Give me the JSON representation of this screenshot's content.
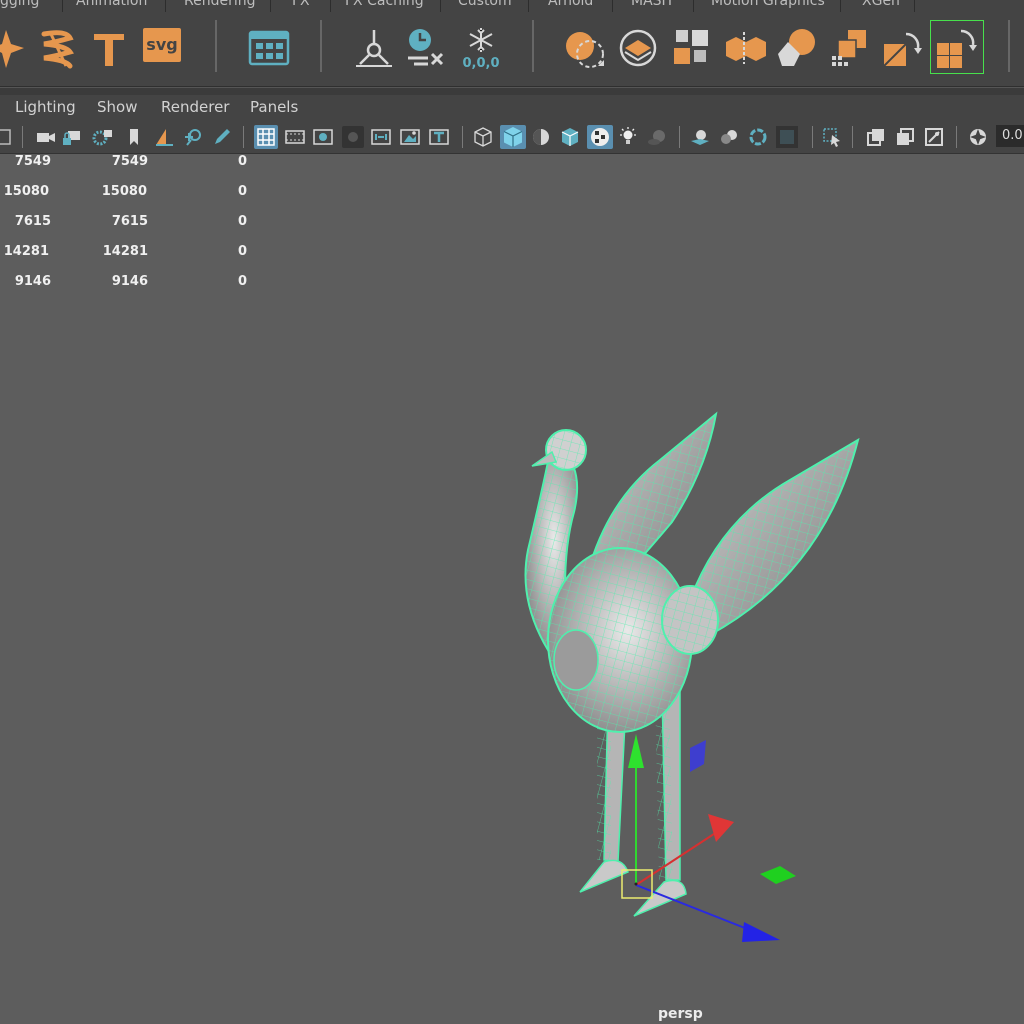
{
  "tabs": [
    "gging",
    "Animation",
    "Rendering",
    "FX",
    "FX Caching",
    "Custom",
    "Arnold",
    "MASH",
    "Motion Graphics",
    "XGen"
  ],
  "shelf": {
    "svg_label": "svg",
    "snowflake_readout": "0,0,0"
  },
  "panel_menu": [
    "Lighting",
    "Show",
    "Renderer",
    "Panels"
  ],
  "toolbar": {
    "field_value": "0.0"
  },
  "hud": {
    "rows": [
      [
        "7549",
        "7549",
        "0"
      ],
      [
        "15080",
        "15080",
        "0"
      ],
      [
        "7615",
        "7615",
        "0"
      ],
      [
        "14281",
        "14281",
        "0"
      ],
      [
        "9146",
        "9146",
        "0"
      ]
    ]
  },
  "viewport": {
    "camera": "persp"
  },
  "colors": {
    "shelf_orange": "#e6974e",
    "shelf_teal": "#5fb0c1",
    "wireframe": "#4ff0ad",
    "active_blue": "#5a8fb0"
  }
}
